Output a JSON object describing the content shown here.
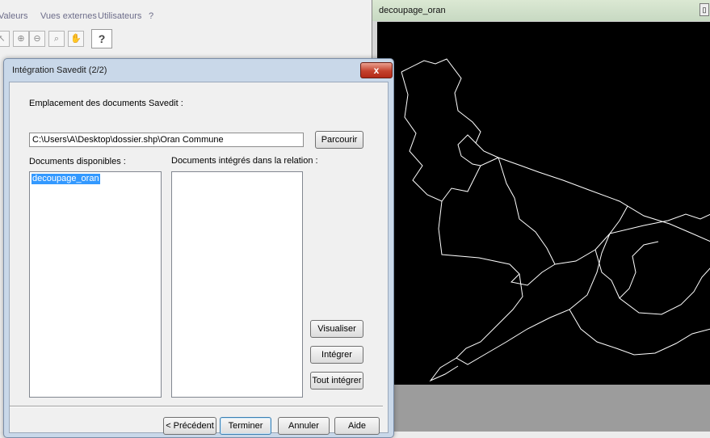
{
  "menubar": {
    "items": [
      "Valeurs",
      "Vues externes",
      "Utilisateurs",
      "?"
    ]
  },
  "toolbar": {
    "icons": [
      "select-arrow-icon",
      "zoom-in-icon",
      "zoom-out-icon",
      "zoom-window-icon",
      "pan-hand-icon",
      "help-pointer-icon"
    ],
    "help_glyph": "?"
  },
  "map_window": {
    "title": "decoupage_oran",
    "background": "#000000",
    "line_color": "#ffffff"
  },
  "dialog": {
    "title": "Intégration Savedit (2/2)",
    "close_glyph": "x",
    "location_label": "Emplacement des documents Savedit :",
    "location_value": "C:\\Users\\A\\Desktop\\dossier.shp\\Oran Commune",
    "browse_label": "Parcourir",
    "available_label": "Documents disponibles :",
    "available_items": [
      "decoupage_oran"
    ],
    "integrated_label": "Documents intégrés dans la relation :",
    "integrated_items": [],
    "visualize_label": "Visualiser",
    "integrate_label": "Intégrer",
    "integrate_all_label": "Tout intégrer",
    "prev_label": "< Précédent",
    "finish_label": "Terminer",
    "cancel_label": "Annuler",
    "help_label": "Aide",
    "accent": "#3399ff"
  }
}
